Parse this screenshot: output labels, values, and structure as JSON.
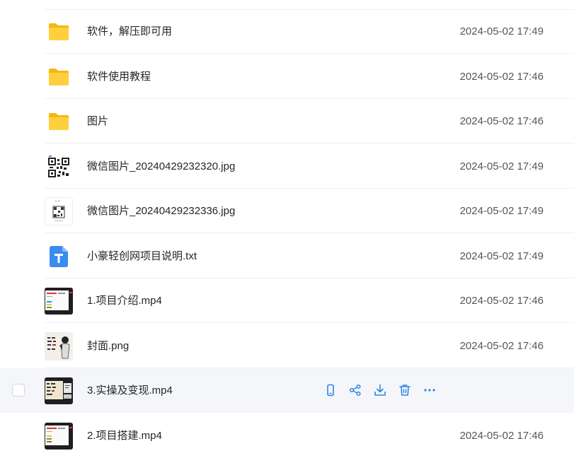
{
  "accent_color": "#2b85e4",
  "files": [
    {
      "name": "软件，解压即可用",
      "date": "2024-05-02 17:49",
      "icon": "folder-icon"
    },
    {
      "name": "软件使用教程",
      "date": "2024-05-02 17:46",
      "icon": "folder-icon"
    },
    {
      "name": "图片",
      "date": "2024-05-02 17:46",
      "icon": "folder-icon"
    },
    {
      "name": "微信图片_20240429232320.jpg",
      "date": "2024-05-02 17:49",
      "icon": "image-thumbnail-qr"
    },
    {
      "name": "微信图片_20240429232336.jpg",
      "date": "2024-05-02 17:49",
      "icon": "image-thumbnail-qr-small"
    },
    {
      "name": "小豪轻创网项目说明.txt",
      "date": "2024-05-02 17:49",
      "icon": "text-file-icon"
    },
    {
      "name": "1.项目介绍.mp4",
      "date": "2024-05-02 17:46",
      "icon": "video-thumbnail"
    },
    {
      "name": "封面.png",
      "date": "2024-05-02 17:46",
      "icon": "image-thumbnail-cover"
    },
    {
      "name": "3.实操及变现.mp4",
      "date": "",
      "icon": "video-thumbnail",
      "hovered": true
    },
    {
      "name": "2.项目搭建.mp4",
      "date": "2024-05-02 17:46",
      "icon": "video-thumbnail"
    }
  ],
  "hover_actions": [
    "phone-icon",
    "share-icon",
    "download-icon",
    "delete-icon",
    "more-icon"
  ]
}
